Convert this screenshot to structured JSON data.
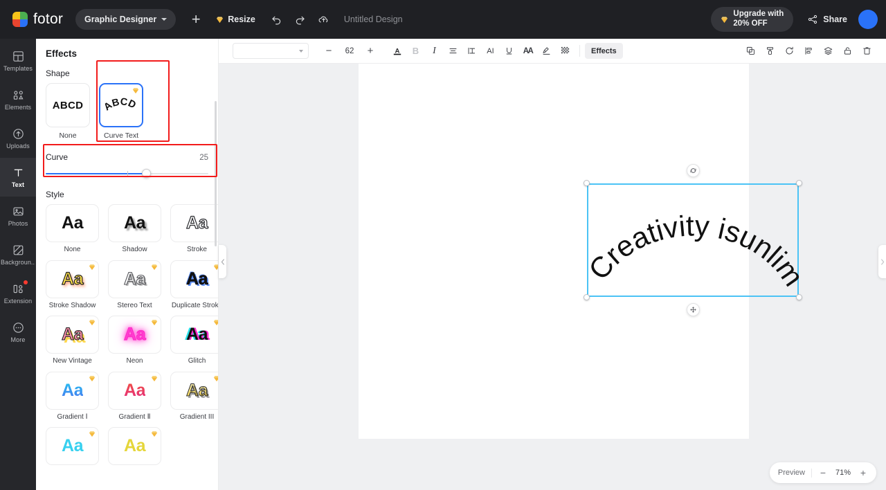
{
  "topbar": {
    "brand": "fotor",
    "mode_pill": "Graphic Designer",
    "add_label": "+",
    "resize_label": "Resize",
    "undo_label": "undo",
    "redo_label": "redo",
    "cloud_label": "cloud-save",
    "doc_title": "Untitled Design",
    "upgrade_line1": "Upgrade with",
    "upgrade_line2": "20% OFF",
    "share_label": "Share",
    "accent_blue": "#2a72f8",
    "bar_bg": "#1f2024"
  },
  "rail": {
    "items": [
      {
        "label": "Templates",
        "icon": "templates-icon",
        "active": false
      },
      {
        "label": "Elements",
        "icon": "elements-icon",
        "active": false
      },
      {
        "label": "Uploads",
        "icon": "uploads-icon",
        "active": false
      },
      {
        "label": "Text",
        "icon": "text-icon",
        "active": true
      },
      {
        "label": "Photos",
        "icon": "photos-icon",
        "active": false
      },
      {
        "label": "Backgroun...",
        "icon": "background-icon",
        "active": false
      },
      {
        "label": "Extension",
        "icon": "extension-icon",
        "active": false,
        "badge": true
      },
      {
        "label": "More",
        "icon": "more-icon",
        "active": false
      }
    ]
  },
  "panel": {
    "title": "Effects",
    "shape_label": "Shape",
    "shapes": [
      {
        "caption": "None",
        "preview": "ABCD",
        "selected": false,
        "premium": false
      },
      {
        "caption": "Curve Text",
        "preview": "ABCD",
        "selected": true,
        "premium": true
      }
    ],
    "curve": {
      "label": "Curve",
      "value": "25",
      "fill_percent": 62,
      "tick_percent": 50
    },
    "style_label": "Style",
    "styles": [
      {
        "caption": "None",
        "preview": "Aa",
        "premium": false,
        "cls": "aa-none"
      },
      {
        "caption": "Shadow",
        "preview": "Aa",
        "premium": false,
        "cls": "aa-shadow"
      },
      {
        "caption": "Stroke",
        "preview": "Aa",
        "premium": false,
        "cls": "aa-stroke"
      },
      {
        "caption": "Stroke Shadow",
        "preview": "Aa",
        "premium": true,
        "cls": "aa-strokeshadow"
      },
      {
        "caption": "Stereo Text",
        "preview": "Aa",
        "premium": true,
        "cls": "aa-stereo"
      },
      {
        "caption": "Duplicate Stroke",
        "preview": "Aa",
        "premium": true,
        "cls": "aa-duplicate"
      },
      {
        "caption": "New Vintage",
        "preview": "Aa",
        "premium": true,
        "cls": "aa-vintage"
      },
      {
        "caption": "Neon",
        "preview": "Aa",
        "premium": true,
        "cls": "aa-neon"
      },
      {
        "caption": "Glitch",
        "preview": "Aa",
        "premium": true,
        "cls": "aa-glitch"
      },
      {
        "caption": "Gradient Ⅰ",
        "preview": "Aa",
        "premium": true,
        "cls": "aa-g1"
      },
      {
        "caption": "Gradient Ⅱ",
        "preview": "Aa",
        "premium": true,
        "cls": "aa-g2"
      },
      {
        "caption": "Gradient III",
        "preview": "Aa",
        "premium": true,
        "cls": "aa-g3"
      }
    ],
    "highlight_color": "#f21b1b"
  },
  "toolbar": {
    "font_value": "",
    "font_placeholder": "",
    "font_size": "62",
    "decrease_label": "−",
    "increase_label": "+",
    "effects_label": "Effects",
    "icons": [
      {
        "name": "text-color-icon",
        "glyph": "A",
        "dim": false
      },
      {
        "name": "bold-icon",
        "glyph": "B",
        "dim": true
      },
      {
        "name": "italic-icon",
        "glyph": "I",
        "dim": false
      },
      {
        "name": "align-icon",
        "glyph": "≡",
        "dim": false
      },
      {
        "name": "line-height-icon",
        "glyph": "↓↑",
        "dim": false
      },
      {
        "name": "ai-writer-icon",
        "glyph": "AI",
        "dim": false
      },
      {
        "name": "underline-icon",
        "glyph": "U",
        "dim": false
      },
      {
        "name": "letter-spacing-icon",
        "glyph": "AA",
        "dim": false
      },
      {
        "name": "highlight-icon",
        "glyph": "✐",
        "dim": false
      },
      {
        "name": "transparency-icon",
        "glyph": "░",
        "dim": false
      }
    ],
    "right_icons": [
      {
        "name": "duplicate-icon"
      },
      {
        "name": "format-painter-icon"
      },
      {
        "name": "replace-icon"
      },
      {
        "name": "align-position-icon"
      },
      {
        "name": "layers-icon"
      },
      {
        "name": "lock-icon"
      },
      {
        "name": "delete-icon"
      }
    ]
  },
  "canvas": {
    "text": "Creativity isunlimited",
    "selection_width": "306",
    "selection_height": "164",
    "rotate_label": "rotate",
    "move_label": "move"
  },
  "zoombar": {
    "preview_label": "Preview",
    "minus_label": "−",
    "zoom_value": "71%",
    "plus_label": "+"
  }
}
